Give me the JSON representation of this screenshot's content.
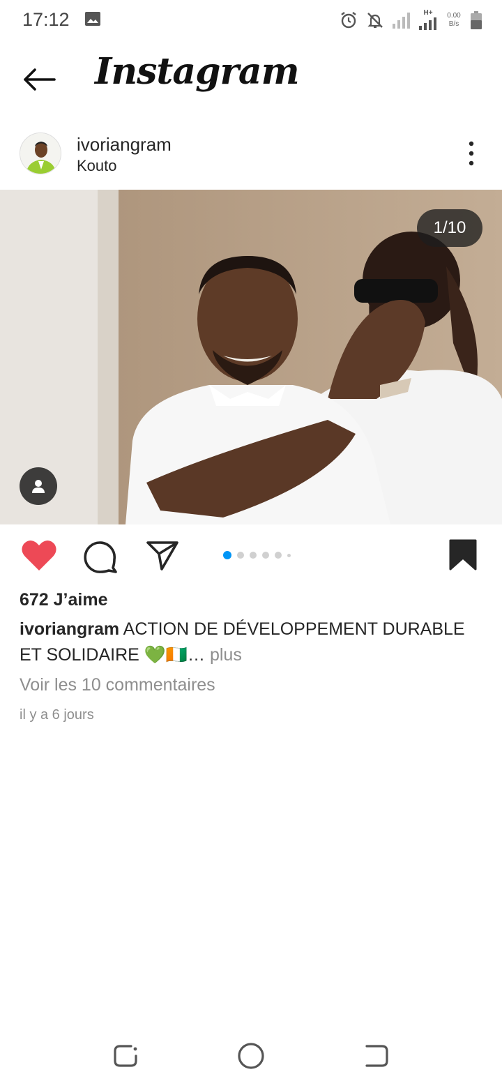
{
  "status_bar": {
    "time": "17:12",
    "network_type": "H+",
    "net_speed_value": "0.00",
    "net_speed_unit": "B/s",
    "icons": [
      "gallery-icon",
      "alarm-icon",
      "notifications-off-icon",
      "signal-icon",
      "signal-icon",
      "battery-icon"
    ]
  },
  "header": {
    "app_name": "Instagram",
    "back_icon": "arrow-left-icon"
  },
  "post": {
    "username": "ivoriangram",
    "location": "Kouto",
    "more_icon": "more-vertical-icon",
    "image_counter": "1/10",
    "tag_icon": "person-icon",
    "likes": "672 J’aime",
    "caption_user": "ivoriangram",
    "caption_text": " ACTION DE DÉVELOPPEMENT DURABLE ET SOLIDAIRE 💚🇨🇮…",
    "caption_more": " plus",
    "view_comments": "Voir les 10 commentaires",
    "timestamp": "il y a 6 jours",
    "liked": true,
    "saved": true,
    "carousel_position": 1,
    "carousel_total": 10
  },
  "colors": {
    "like_red": "#ed4956",
    "active_dot_blue": "#0095f6",
    "muted_text": "#8e8e8e",
    "primary_text": "#262626"
  },
  "nav_bar": {
    "icons": [
      "recent-apps-icon",
      "home-icon",
      "back-icon"
    ]
  }
}
